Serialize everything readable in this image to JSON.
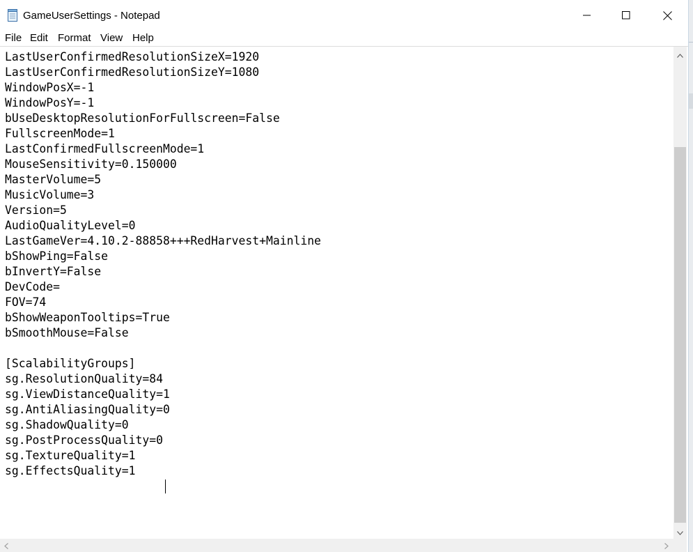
{
  "window": {
    "title": "GameUserSettings - Notepad",
    "icons": {
      "app": "notepad-icon",
      "minimize": "minimize-icon",
      "maximize": "maximize-icon",
      "close": "close-icon"
    }
  },
  "menu": {
    "file": "File",
    "edit": "Edit",
    "format": "Format",
    "view": "View",
    "help": "Help"
  },
  "editor": {
    "text": "LastUserConfirmedResolutionSizeX=1920\nLastUserConfirmedResolutionSizeY=1080\nWindowPosX=-1\nWindowPosY=-1\nbUseDesktopResolutionForFullscreen=False\nFullscreenMode=1\nLastConfirmedFullscreenMode=1\nMouseSensitivity=0.150000\nMasterVolume=5\nMusicVolume=3\nVersion=5\nAudioQualityLevel=0\nLastGameVer=4.10.2-88858+++RedHarvest+Mainline\nbShowPing=False\nbInvertY=False\nDevCode=\nFOV=74\nbShowWeaponTooltips=True\nbSmoothMouse=False\n\n[ScalabilityGroups]\nsg.ResolutionQuality=84\nsg.ViewDistanceQuality=1\nsg.AntiAliasingQuality=0\nsg.ShadowQuality=0\nsg.PostProcessQuality=0\nsg.TextureQuality=1\nsg.EffectsQuality=1"
  },
  "scrollbars": {
    "icons": {
      "up": "arrow-up-icon",
      "down": "arrow-down-icon",
      "left": "arrow-left-icon",
      "right": "arrow-right-icon"
    }
  }
}
